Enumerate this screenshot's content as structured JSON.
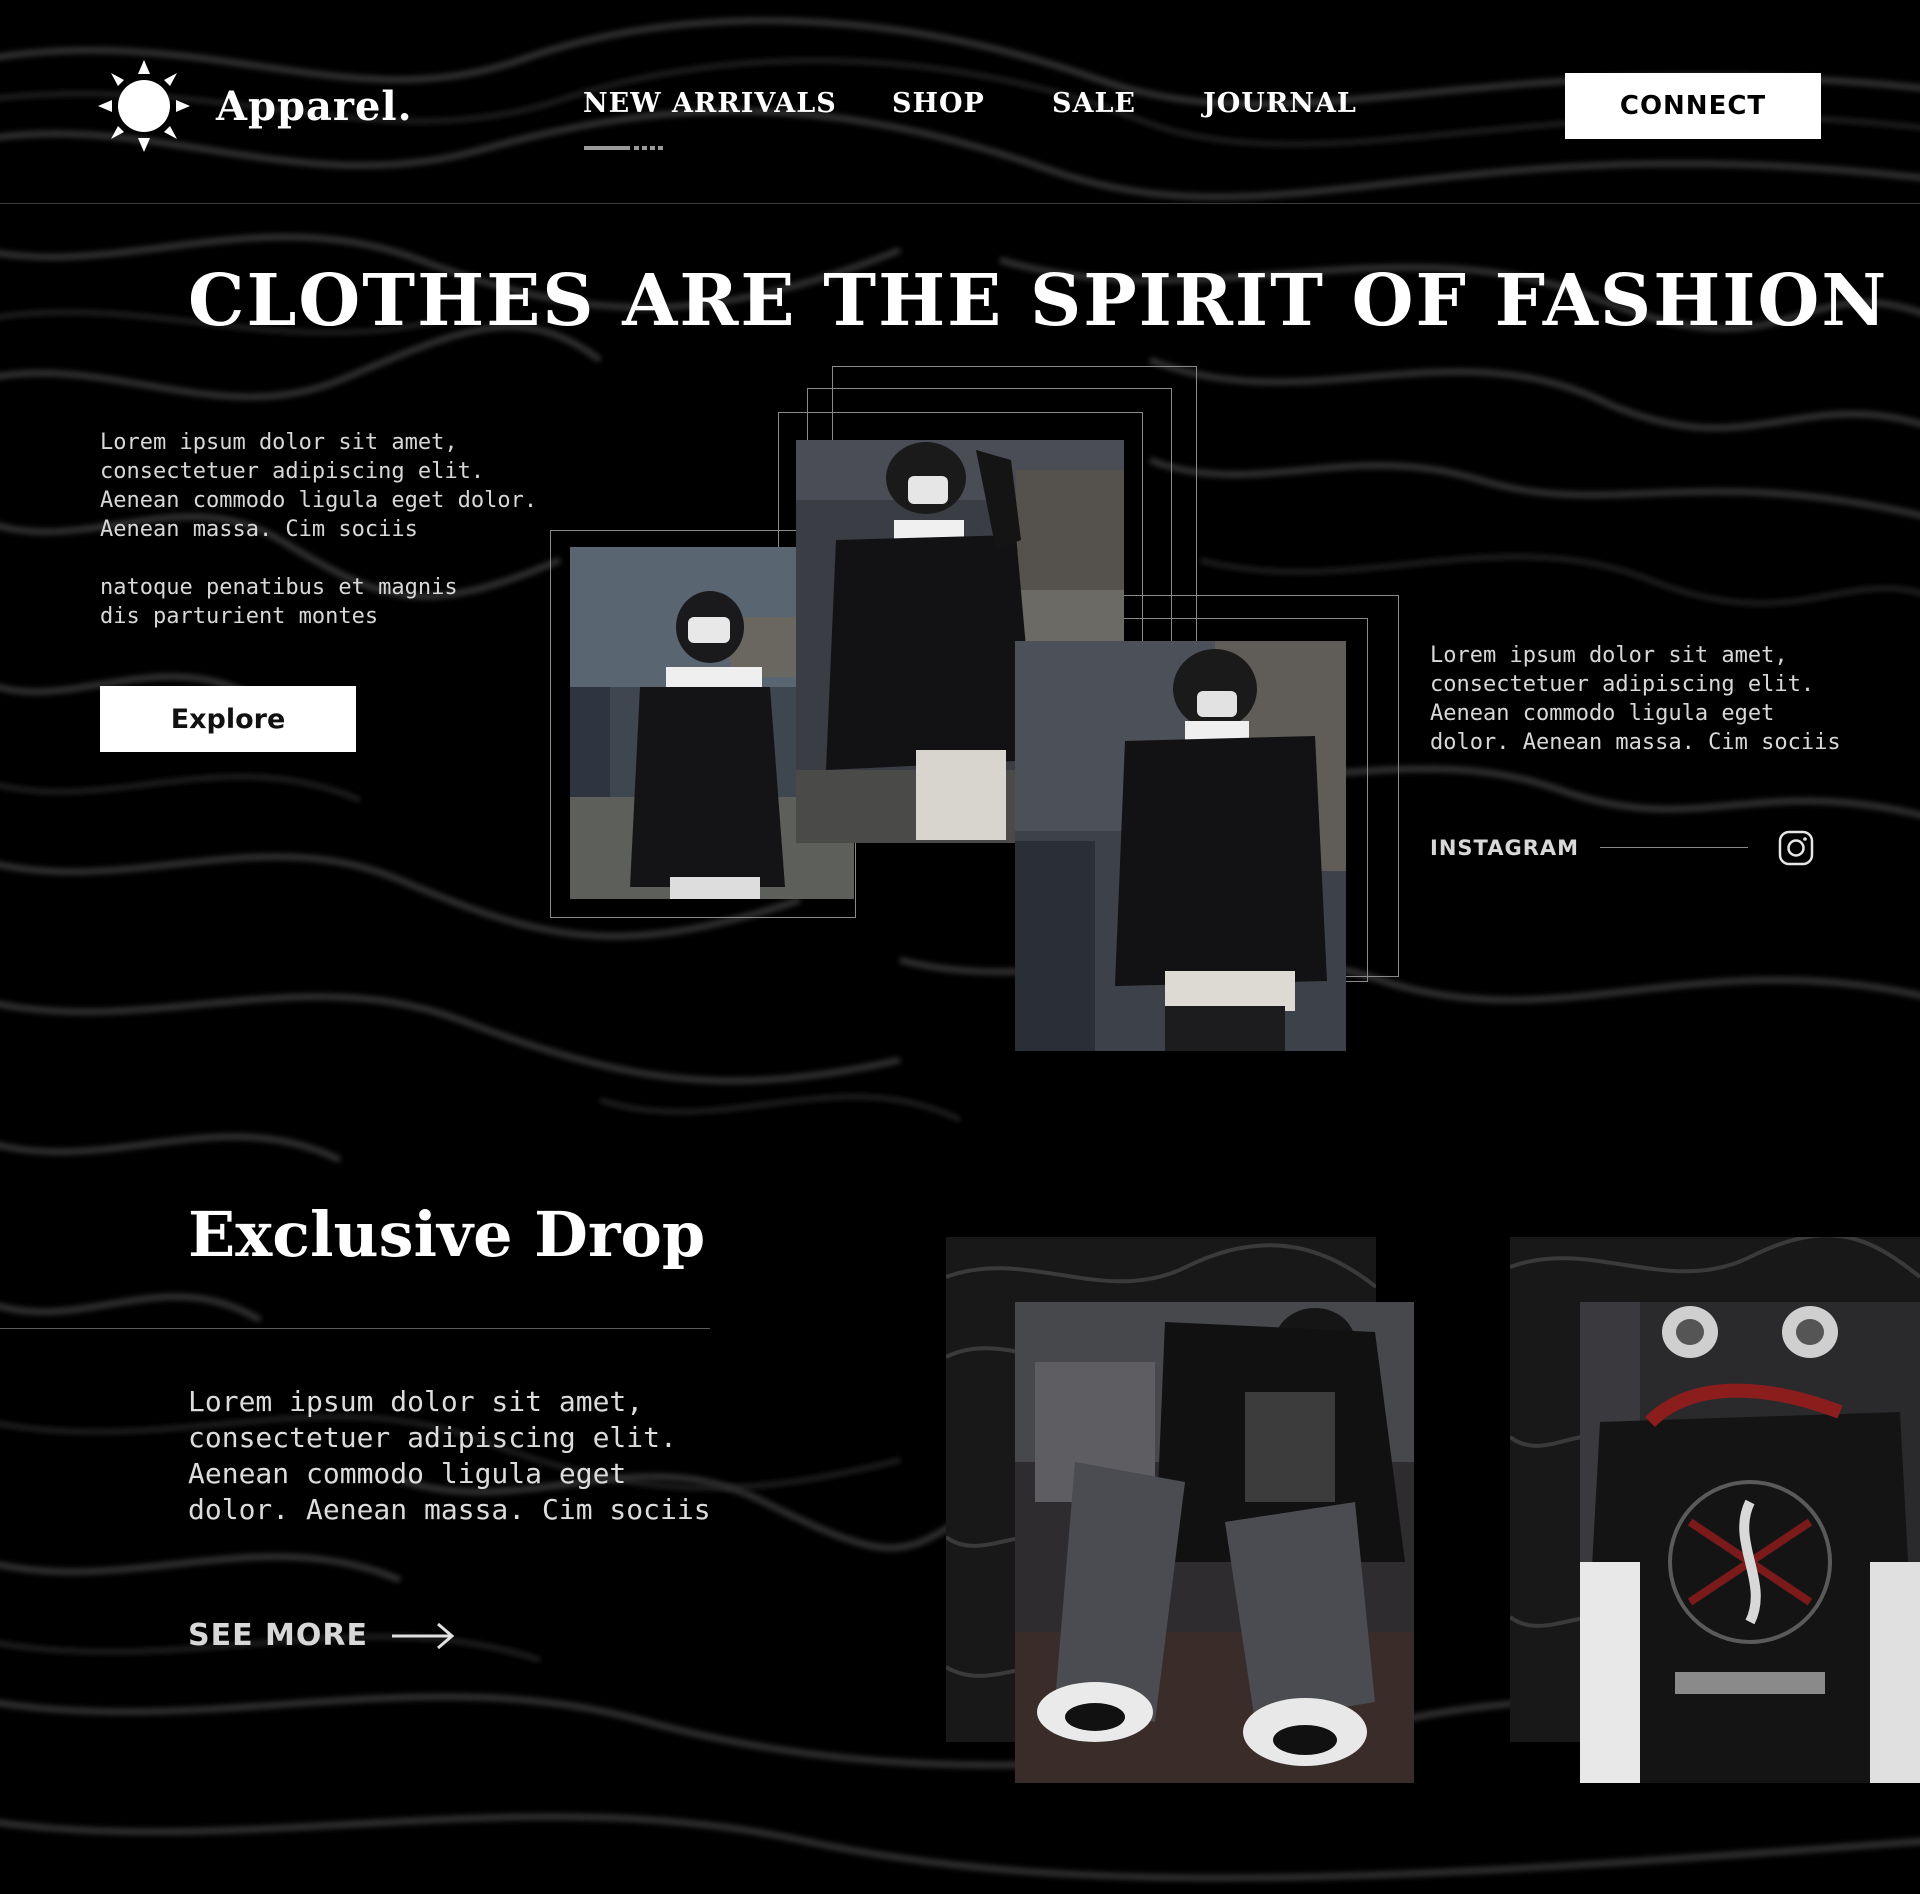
{
  "brand": {
    "name": "Apparel.",
    "logo_icon": "sun-icon"
  },
  "nav": {
    "items": [
      {
        "label": "NEW ARRIVALS",
        "active": true
      },
      {
        "label": "SHOP"
      },
      {
        "label": "SALE"
      },
      {
        "label": "JOURNAL"
      }
    ],
    "connect_label": "CONNECT"
  },
  "hero": {
    "title": "CLOTHES ARE THE SPIRIT OF FASHION",
    "left_text": "Lorem ipsum dolor sit amet,\nconsectetuer adipiscing elit.\nAenean commodo ligula eget dolor.\nAenean massa. Cim sociis\n\nnatoque penatibus et magnis\ndis parturient montes",
    "explore_label": "Explore",
    "right_text": "Lorem ipsum dolor sit amet,\nconsectetuer adipiscing elit.\nAenean commodo ligula eget\ndolor. Aenean massa. Cim sociis",
    "instagram_label": "INSTAGRAM",
    "instagram_icon": "instagram-icon"
  },
  "drop": {
    "title": "Exclusive Drop",
    "text": "Lorem ipsum dolor sit amet,\nconsectetuer adipiscing elit.\nAenean commodo ligula eget\ndolor. Aenean massa. Cim sociis",
    "see_more_label": "SEE MORE",
    "arrow_icon": "arrow-right-icon"
  },
  "colors": {
    "background": "#000000",
    "text": "#ffffff",
    "muted": "#d8d8d8",
    "rule": "#3a3a3a"
  }
}
